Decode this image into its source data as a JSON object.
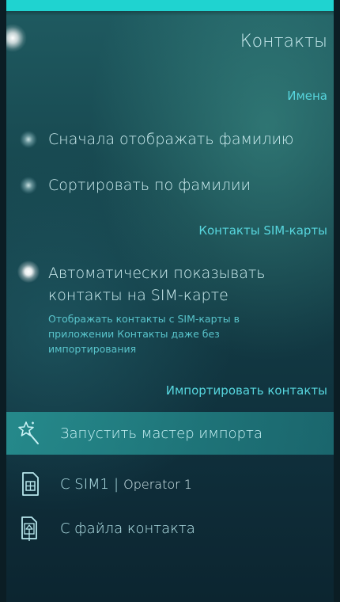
{
  "page": {
    "title": "Контакты"
  },
  "sections": {
    "names": "Имена",
    "sim": "Контакты SIM-карты",
    "import": "Импортировать контакты"
  },
  "switches": [
    {
      "label": "Сначала отображать фамилию",
      "checked": false
    },
    {
      "label": "Сортировать по фамилии",
      "checked": false
    },
    {
      "label_line1": "Автоматически показывать",
      "label_line2": "контакты на SIM-карте",
      "description_line1": "Отображать контакты с SIM-карты в",
      "description_line2": "приложении Контакты даже без",
      "description_line3": "импортирования",
      "checked": true
    }
  ],
  "import_items": [
    {
      "label": "Запустить мастер импорта",
      "icon": "magic-wand-icon",
      "highlighted": true
    },
    {
      "label": "C SIM1",
      "separator": "|",
      "operator": "Operator 1",
      "icon": "sim-card-icon"
    },
    {
      "label": "С файла контакта",
      "icon": "contact-file-icon"
    }
  ],
  "colors": {
    "accent": "#57d6de",
    "top_bar": "#1fd3d0",
    "highlight": "#2a9696",
    "primary_text": "#cfeff2"
  }
}
